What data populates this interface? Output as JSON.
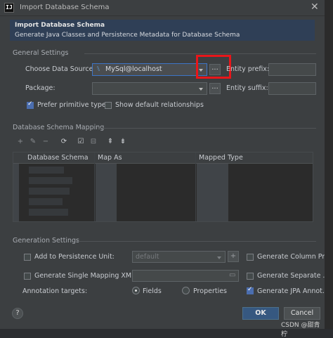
{
  "window": {
    "title": "Import Database Schema",
    "app_icon": "IJ"
  },
  "header": {
    "title": "Import Database Schema",
    "subtitle": "Generate Java Classes and Persistence Metadata for Database Schema"
  },
  "general": {
    "section_label": "General Settings",
    "data_source_label": "Choose Data Source:",
    "data_source_value": "MySql@localhost",
    "browse_label": "...",
    "package_label": "Package:",
    "package_value": "",
    "entity_prefix_label": "Entity prefix:",
    "entity_prefix_value": "",
    "entity_suffix_label": "Entity suffix:",
    "entity_suffix_value": "",
    "prefer_primitive_label": "Prefer primitive types",
    "prefer_primitive_checked": true,
    "show_default_label": "Show default relationships",
    "show_default_checked": false
  },
  "mapping": {
    "section_label": "Database Schema Mapping",
    "columns": [
      "Database Schema",
      "Map As",
      "Mapped Type"
    ],
    "toolbar_icons": [
      "plus-icon",
      "edit-icon",
      "minus-icon",
      "refresh-icon",
      "check-all-icon",
      "uncheck-all-icon",
      "expand-all-icon",
      "collapse-all-icon"
    ]
  },
  "generation": {
    "section_label": "Generation Settings",
    "add_to_unit_label": "Add to Persistence Unit:",
    "add_to_unit_checked": false,
    "unit_value": "default",
    "gen_column_label": "Generate Column Pr...",
    "gen_column_checked": false,
    "gen_single_label": "Generate Single Mapping XML:",
    "gen_single_checked": false,
    "gen_separate_label": "Generate Separate ...",
    "gen_separate_checked": false,
    "annotation_label": "Annotation targets:",
    "fields_label": "Fields",
    "fields_selected": true,
    "properties_label": "Properties",
    "properties_selected": false,
    "gen_jpa_label": "Generate JPA Annot...",
    "gen_jpa_checked": true
  },
  "buttons": {
    "help": "?",
    "ok": "OK",
    "cancel": "Cancel"
  },
  "watermark": "CSDN @甜青柠",
  "colors": {
    "accent": "#365880",
    "highlight": "#e8161a",
    "header_bg": "#2f3f56"
  }
}
